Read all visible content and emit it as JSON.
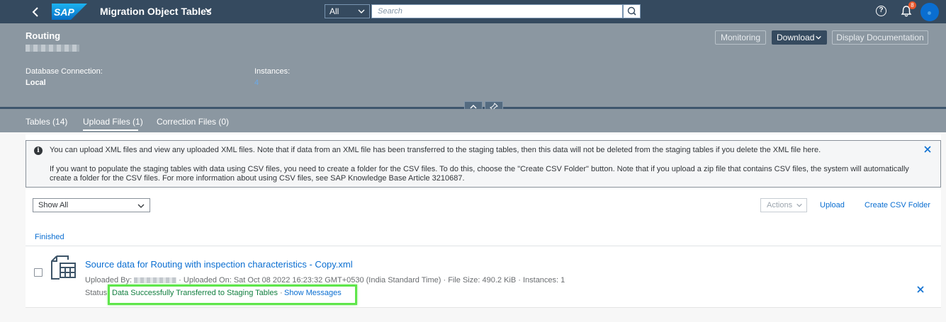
{
  "shell": {
    "logo_text": "SAP",
    "app_title": "Migration Object Tables",
    "scope": "All",
    "search_placeholder": "Search",
    "notification_count": "8",
    "colors": {
      "shell_bg": "#354a5f",
      "accent": "#0a6ed1",
      "badge": "#e6562b"
    }
  },
  "header": {
    "title": "Routing",
    "subtitle_redacted": true,
    "database_connection_label": "Database Connection:",
    "database_connection_value": "Local",
    "instances_label": "Instances:",
    "instances_value": "4",
    "buttons": {
      "monitoring": "Monitoring",
      "download": "Download",
      "display_documentation": "Display Documentation"
    }
  },
  "tabs": [
    {
      "label": "Tables (14)"
    },
    {
      "label": "Upload Files (1)",
      "selected": true
    },
    {
      "label": "Correction Files (0)"
    }
  ],
  "info": {
    "line1": "You can upload XML files and view any uploaded XML files. Note that if data from an XML file has been transferred to the staging tables, then this data will not be deleted from the staging tables if you delete the XML file here.",
    "line2": "If you want to populate the staging tables with data using CSV files, you need to create a folder for the CSV files. To do this, choose the \"Create CSV Folder\" button. Note that if you upload a zip file that contains CSV files, the system will automatically",
    "line3": "create a folder for the CSV files. For more information about using CSV files, see SAP Knowledge Base Article 3210687."
  },
  "toolbar": {
    "filter_value": "Show All",
    "actions": "Actions",
    "upload": "Upload",
    "create_csv_folder": "Create CSV Folder"
  },
  "list": {
    "section": "Finished",
    "items": [
      {
        "file_name": "Source data for Routing with inspection characteristics - Copy.xml",
        "uploaded_by_label": "Uploaded By:",
        "details": "· Uploaded On: Sat Oct 08 2022 16:23:32 GMT+0530 (India Standard Time) · File Size: 490.2 KiB · Instances: 1",
        "status_label": "Status:",
        "status_value": "Data Successfully Transferred to Staging Tables",
        "status_sep": "·",
        "show_messages": "Show Messages"
      }
    ]
  }
}
